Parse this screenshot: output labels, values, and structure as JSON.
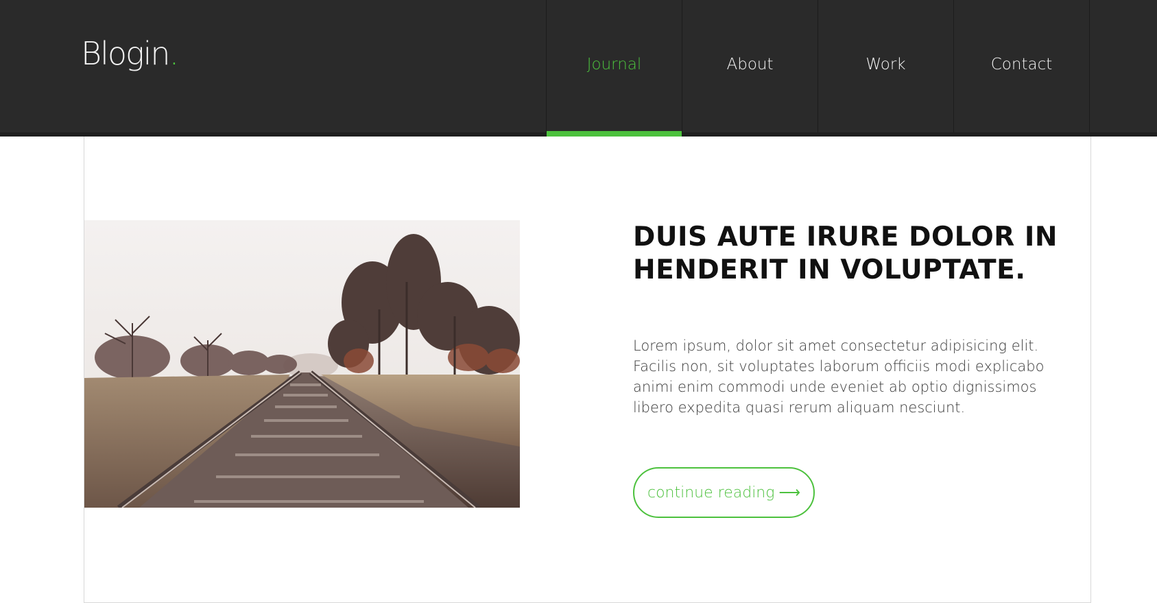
{
  "brand": {
    "name": "Blogin",
    "dot": ".",
    "accent_color": "#4cc13d"
  },
  "nav": {
    "items": [
      {
        "label": "Journal",
        "active": true
      },
      {
        "label": "About",
        "active": false
      },
      {
        "label": "Work",
        "active": false
      },
      {
        "label": "Contact",
        "active": false
      }
    ]
  },
  "post": {
    "image_alt": "railway tracks through autumn trees",
    "title": "DUIS AUTE IRURE DOLOR IN HENDERIT IN VOLUPTATE.",
    "excerpt": "Lorem ipsum, dolor sit amet consectetur adipisicing elit. Facilis non, sit voluptates laborum officiis modi explicabo animi enim commodi unde eveniet ab optio dignissimos libero expedita quasi rerum aliquam nesciunt.",
    "cta_label": "continue reading",
    "cta_arrow": "⟶",
    "cta_icon": "long-arrow-right-icon"
  }
}
